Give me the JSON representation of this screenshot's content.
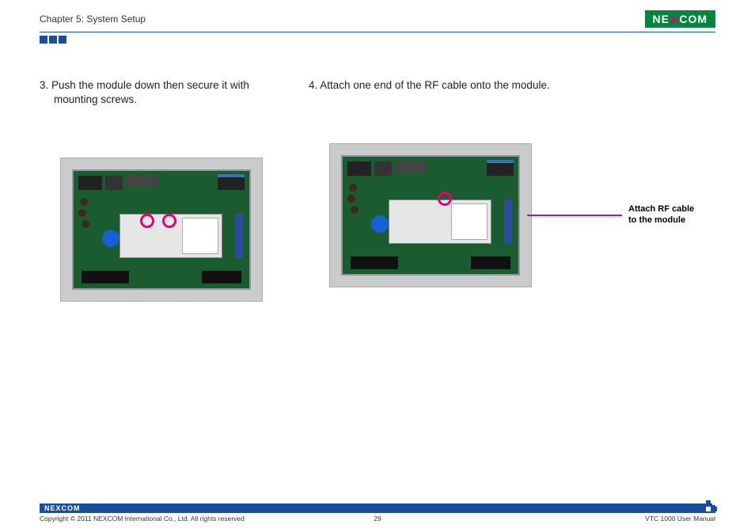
{
  "header": {
    "chapter": "Chapter 5: System Setup",
    "logo_left": "NE",
    "logo_x": "X",
    "logo_right": "COM"
  },
  "steps": {
    "s3": "3.   Push the module down then secure it with mounting screws.",
    "s4": "4.   Attach one end of the RF cable onto the module."
  },
  "callout": {
    "line1": "Attach RF cable",
    "line2": "to the module"
  },
  "footer": {
    "logo": "NEXCOM",
    "copyright": "Copyright © 2011 NEXCOM International Co., Ltd. All rights reserved",
    "page": "29",
    "doc": "VTC 1000 User Manual"
  }
}
